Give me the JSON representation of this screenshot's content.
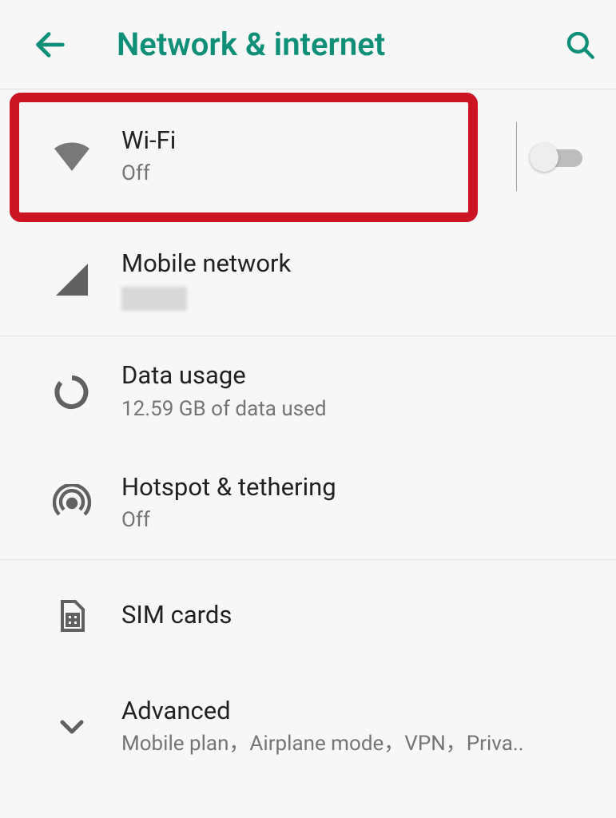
{
  "header": {
    "title": "Network & internet"
  },
  "items": {
    "wifi": {
      "title": "Wi-Fi",
      "subtitle": "Off",
      "toggle": false
    },
    "mobile": {
      "title": "Mobile network"
    },
    "datausage": {
      "title": "Data usage",
      "subtitle": "12.59 GB of data used"
    },
    "hotspot": {
      "title": "Hotspot & tethering",
      "subtitle": "Off"
    },
    "sim": {
      "title": "SIM cards"
    },
    "advanced": {
      "title": "Advanced",
      "subtitle": "Mobile plan，Airplane mode，VPN，Priva.."
    }
  }
}
